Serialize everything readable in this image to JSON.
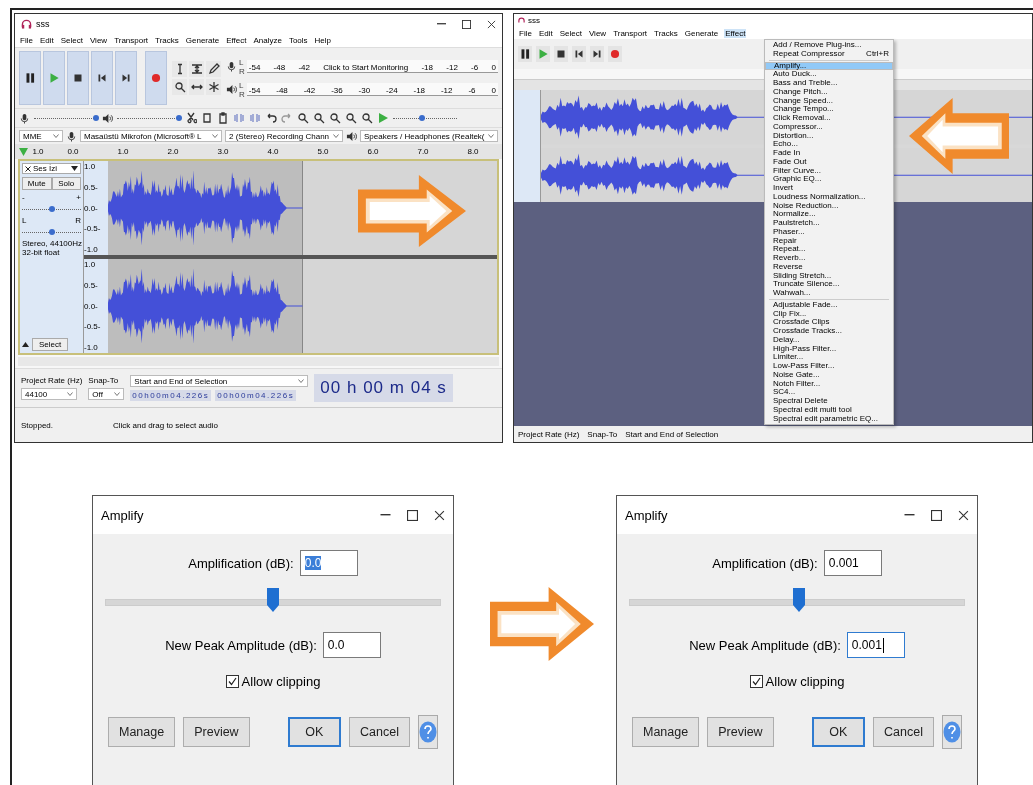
{
  "editor": {
    "title": "sss",
    "menus": [
      "File",
      "Edit",
      "Select",
      "View",
      "Transport",
      "Tracks",
      "Generate",
      "Effect",
      "Analyze",
      "Tools",
      "Help"
    ],
    "record_meter": {
      "channels": [
        "L",
        "R"
      ],
      "ticks": [
        "-54",
        "-48",
        "-42",
        "Click to Start Monitoring",
        "-18",
        "-12",
        "-6",
        "0"
      ]
    },
    "play_meter": {
      "channels": [
        "L",
        "R"
      ],
      "ticks": [
        "-54",
        "-48",
        "-42",
        "-36",
        "-30",
        "-24",
        "-18",
        "-12",
        "-6",
        "0"
      ]
    },
    "recording_volume": {
      "level": 0.97
    },
    "playback_volume": {
      "level": 0.97
    },
    "play_speed": {
      "level": 0.45
    },
    "devices": {
      "host": "MME",
      "microphone": "Masaüstü Mikrofon (Microsoft® L",
      "channels": "2 (Stereo) Recording Chann",
      "speakers": "Speakers / Headphones (Realtek("
    },
    "ruler": [
      "1.0",
      "0.0",
      "1.0",
      "2.0",
      "3.0",
      "4.0",
      "5.0",
      "6.0",
      "7.0",
      "8.0"
    ],
    "track": {
      "name": "Ses İzi",
      "mute": "Mute",
      "solo": "Solo",
      "gain_labels": [
        "-",
        "+"
      ],
      "gain": {
        "level": 0.5
      },
      "pan_labels": [
        "L",
        "R"
      ],
      "pan": {
        "level": 0.5
      },
      "info": [
        "Stereo, 44100Hz",
        "32-bit float"
      ],
      "select": "Select",
      "scales": [
        [
          "1.0",
          "0.5-",
          "0.0-",
          "-0.5-",
          "-1.0"
        ],
        [
          "1.0",
          "0.5-",
          "0.0-",
          "-0.5-",
          "-1.0"
        ]
      ]
    },
    "selection_bar": {
      "rate_label": "Project Rate (Hz)",
      "snap_label": "Snap-To",
      "mode": "Start and End of Selection",
      "rate": "44100",
      "snap": "Off",
      "start": "00h00m04.226s",
      "end": "00h00m04.226s",
      "position": "00 h 00 m 04 s"
    },
    "status": [
      "Stopped.",
      "Click and drag to select audio"
    ]
  },
  "menu_screen": {
    "title": "sss",
    "menus": [
      {
        "label": "File",
        "selected": false
      },
      {
        "label": "Edit",
        "selected": false
      },
      {
        "label": "Select",
        "selected": false
      },
      {
        "label": "View",
        "selected": false
      },
      {
        "label": "Transport",
        "selected": false
      },
      {
        "label": "Tracks",
        "selected": false
      },
      {
        "label": "Generate",
        "selected": false
      },
      {
        "label": "Effect",
        "selected": true
      }
    ],
    "effect_menu": [
      [
        {
          "label": "Add / Remove Plug-ins...",
          "selected": false
        },
        {
          "label": "Repeat Compressor",
          "shortcut": "Ctrl+R",
          "selected": false
        }
      ],
      [
        {
          "label": "Amplify...",
          "selected": true
        },
        {
          "label": "Auto Duck...",
          "selected": false
        },
        {
          "label": "Bass and Treble...",
          "selected": false
        },
        {
          "label": "Change Pitch...",
          "selected": false
        },
        {
          "label": "Change Speed...",
          "selected": false
        },
        {
          "label": "Change Tempo...",
          "selected": false
        },
        {
          "label": "Click Removal...",
          "selected": false
        },
        {
          "label": "Compressor...",
          "selected": false
        },
        {
          "label": "Distortion...",
          "selected": false
        },
        {
          "label": "Echo...",
          "selected": false
        },
        {
          "label": "Fade In",
          "selected": false
        },
        {
          "label": "Fade Out",
          "selected": false
        },
        {
          "label": "Filter Curve...",
          "selected": false
        },
        {
          "label": "Graphic EQ...",
          "selected": false
        },
        {
          "label": "Invert",
          "selected": false
        },
        {
          "label": "Loudness Normalization...",
          "selected": false
        },
        {
          "label": "Noise Reduction...",
          "selected": false
        },
        {
          "label": "Normalize...",
          "selected": false
        },
        {
          "label": "Paulstretch...",
          "selected": false
        },
        {
          "label": "Phaser...",
          "selected": false
        },
        {
          "label": "Repair",
          "selected": false
        },
        {
          "label": "Repeat...",
          "selected": false
        },
        {
          "label": "Reverb...",
          "selected": false
        },
        {
          "label": "Reverse",
          "selected": false
        },
        {
          "label": "Sliding Stretch...",
          "selected": false
        },
        {
          "label": "Truncate Silence...",
          "selected": false
        },
        {
          "label": "Wahwah...",
          "selected": false
        }
      ],
      [
        {
          "label": "Adjustable Fade...",
          "selected": false
        },
        {
          "label": "Clip Fix...",
          "selected": false
        },
        {
          "label": "Crossfade Clips",
          "selected": false
        },
        {
          "label": "Crossfade Tracks...",
          "selected": false
        },
        {
          "label": "Delay...",
          "selected": false
        },
        {
          "label": "High-Pass Filter...",
          "selected": false
        },
        {
          "label": "Limiter...",
          "selected": false
        },
        {
          "label": "Low-Pass Filter...",
          "selected": false
        },
        {
          "label": "Noise Gate...",
          "selected": false
        },
        {
          "label": "Notch Filter...",
          "selected": false
        },
        {
          "label": "SC4...",
          "selected": false
        },
        {
          "label": "Spectral Delete",
          "selected": false
        },
        {
          "label": "Spectral edit multi tool",
          "selected": false
        },
        {
          "label": "Spectral edit parametric EQ...",
          "selected": false
        }
      ]
    ],
    "bottom_labels": [
      "Project Rate (Hz)",
      "Snap-To",
      "Start and End of Selection"
    ]
  },
  "dialogs": [
    {
      "title": "Amplify",
      "amplification_label": "Amplification (dB):",
      "amplification": "0.0",
      "amplification_selected": true,
      "level": 0.5,
      "peak_label": "New Peak Amplitude (dB):",
      "peak": "0.0",
      "peak_focused": false,
      "clipping_label": "Allow clipping",
      "clipping_checked": true,
      "buttons": [
        "Manage",
        "Preview",
        "OK",
        "Cancel"
      ]
    },
    {
      "title": "Amplify",
      "amplification_label": "Amplification (dB):",
      "amplification": "0.001",
      "amplification_selected": false,
      "level": 0.505,
      "peak_label": "New Peak Amplitude (dB):",
      "peak": "0.001",
      "peak_focused": true,
      "clipping_label": "Allow clipping",
      "clipping_checked": true,
      "buttons": [
        "Manage",
        "Preview",
        "OK",
        "Cancel"
      ]
    }
  ]
}
